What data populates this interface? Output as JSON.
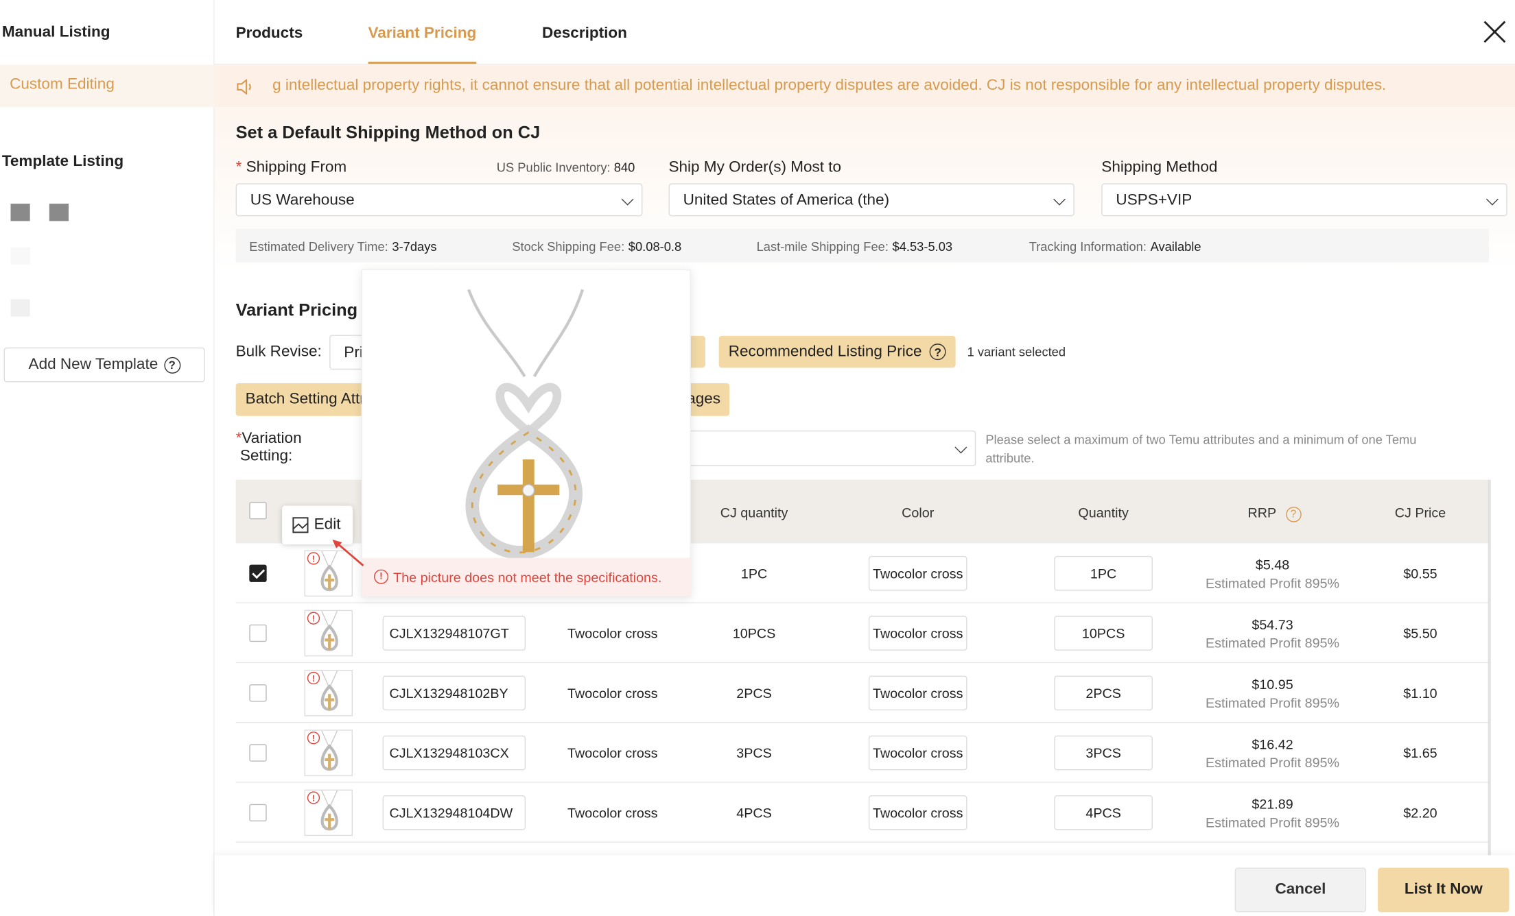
{
  "sidebar": {
    "manual_listing": "Manual Listing",
    "custom_editing": "Custom Editing",
    "template_listing": "Template Listing",
    "add_template": "Add New Template"
  },
  "tabs": [
    "Products",
    "Variant Pricing",
    "Description"
  ],
  "notice": "g intellectual property rights, it cannot ensure that all potential intellectual property disputes are avoided. CJ is not responsible for any intellectual property disputes.",
  "shipping": {
    "title": "Set a Default Shipping Method on CJ",
    "from_label": "Shipping From",
    "inventory_label": "US Public Inventory:",
    "inventory_value": "840",
    "from_value": "US Warehouse",
    "to_label": "Ship My Order(s) Most to",
    "to_value": "United States of America (the)",
    "method_label": "Shipping Method",
    "method_value": "USPS+VIP",
    "delivery_label": "Estimated Delivery Time:",
    "delivery_value": "3-7days",
    "stock_fee_label": "Stock Shipping Fee:",
    "stock_fee_value": "$0.08-0.8",
    "lastmile_label": "Last-mile Shipping Fee:",
    "lastmile_value": "$4.53-5.03",
    "tracking_label": "Tracking Information:",
    "tracking_value": "Available"
  },
  "variant": {
    "title": "Variant Pricing",
    "bulk_label": "Bulk Revise:",
    "bulk_input": "Pri",
    "recommended": "Recommended Listing Price",
    "selected": "1 variant selected",
    "batch_left": "Batch Setting Attr",
    "batch_right": "ages",
    "variation_label_1": "Variation",
    "variation_label_2": "Setting:",
    "hint": "Please select a maximum of two Temu attributes and a minimum of one Temu attribute."
  },
  "table": {
    "headers": {
      "cj_quantity": "CJ quantity",
      "color": "Color",
      "quantity": "Quantity",
      "rrp": "RRP",
      "cj_price": "CJ Price"
    },
    "rows": [
      {
        "sku": "",
        "color_name": "",
        "cj_qty": "1PC",
        "color": "Twocolor cross",
        "qty": "1PC",
        "rrp": "$5.48",
        "profit": "Estimated Profit 895%",
        "price": "$0.55"
      },
      {
        "sku": "CJLX132948107GT",
        "color_name": "Twocolor cross",
        "cj_qty": "10PCS",
        "color": "Twocolor cross",
        "qty": "10PCS",
        "rrp": "$54.73",
        "profit": "Estimated Profit 895%",
        "price": "$5.50"
      },
      {
        "sku": "CJLX132948102BY",
        "color_name": "Twocolor cross",
        "cj_qty": "2PCS",
        "color": "Twocolor cross",
        "qty": "2PCS",
        "rrp": "$10.95",
        "profit": "Estimated Profit 895%",
        "price": "$1.10"
      },
      {
        "sku": "CJLX132948103CX",
        "color_name": "Twocolor cross",
        "cj_qty": "3PCS",
        "color": "Twocolor cross",
        "qty": "3PCS",
        "rrp": "$16.42",
        "profit": "Estimated Profit 895%",
        "price": "$1.65"
      },
      {
        "sku": "CJLX132948104DW",
        "color_name": "Twocolor cross",
        "cj_qty": "4PCS",
        "color": "Twocolor cross",
        "qty": "4PCS",
        "rrp": "$21.89",
        "profit": "Estimated Profit 895%",
        "price": "$2.20"
      }
    ]
  },
  "preview": {
    "error": "The picture does not meet the specifications.",
    "edit": "Edit"
  },
  "footer": {
    "cancel": "Cancel",
    "list": "List It Now"
  },
  "colors": {
    "accent": "#d79a4e",
    "tan_button": "#f2d9a6",
    "error": "#e0443a"
  }
}
